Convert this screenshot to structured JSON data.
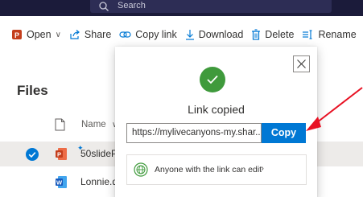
{
  "search": {
    "placeholder": "Search"
  },
  "toolbar": {
    "open_label": "Open",
    "share_label": "Share",
    "copy_link_label": "Copy link",
    "download_label": "Download",
    "delete_label": "Delete",
    "rename_label": "Rename",
    "more_label": "··"
  },
  "page": {
    "title": "Files"
  },
  "list": {
    "name_header": "Name",
    "files": [
      {
        "name": "50slideP",
        "type": "powerpoint",
        "selected": true
      },
      {
        "name": "Lonnie.d",
        "type": "word",
        "selected": false
      }
    ]
  },
  "dialog": {
    "heading": "Link copied",
    "link_value": "https://mylivecanyons-my.shar...",
    "copy_label": "Copy",
    "permission_text": "Anyone with the link can edit"
  },
  "colors": {
    "accent": "#0078d4",
    "success": "#3f9a3c",
    "annotation": "#e81123",
    "topbar": "#1b1b3a"
  }
}
